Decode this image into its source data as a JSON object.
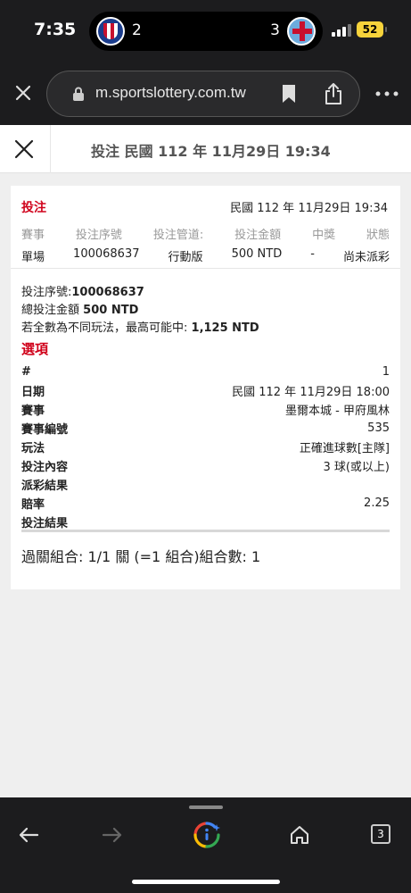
{
  "status_bar": {
    "time": "7:35",
    "live_score": {
      "home_score": "2",
      "away_score": "3"
    },
    "battery": "52"
  },
  "browser": {
    "url": "m.sportslottery.com.tw",
    "tab_count": "3"
  },
  "page": {
    "title": "投注 民國 112 年 11月29日 19:34"
  },
  "bet_card": {
    "label": "投注",
    "datetime": "民國 112 年 11月29日 19:34",
    "summary_headers": [
      "賽事",
      "投注序號",
      "投注管道:",
      "投注金額",
      "中獎",
      "狀態"
    ],
    "summary_values": [
      "單場",
      "100068637",
      "行動版",
      "500 NTD",
      "-",
      "尚未派彩"
    ],
    "serial_label": "投注序號:",
    "serial_value": "100068637",
    "total_label": "總投注金額",
    "total_value": "500 NTD",
    "max_label": "若全數為不同玩法，最高可能中:",
    "max_value": "1,125 NTD",
    "options_title": "選項",
    "details": [
      {
        "key": "#",
        "value": "1"
      },
      {
        "key": "日期",
        "value": "民國 112 年 11月29日 18:00"
      },
      {
        "key": "賽事",
        "value": "墨爾本城 - 甲府風林"
      },
      {
        "key": "賽事編號",
        "value": "535"
      },
      {
        "key": "玩法",
        "value": "正確進球數[主隊]"
      },
      {
        "key": "投注內容",
        "value": "3 球(或以上)"
      },
      {
        "key": "派彩結果",
        "value": ""
      },
      {
        "key": "賠率",
        "value": "2.25"
      },
      {
        "key": "投注結果",
        "value": ""
      }
    ],
    "combo_text": "過關組合: 1/1 關 (=1 組合)組合數: 1"
  },
  "colors": {
    "accent_red": "#d0021b",
    "dark_bar": "#1c1c1e",
    "battery_yellow": "#f7d33b"
  },
  "icons": {
    "toolbar_close": "close-icon",
    "lock": "lock-icon",
    "bookmark": "bookmark-icon",
    "share": "share-icon",
    "more": "more-icon",
    "back": "back-arrow-icon",
    "forward": "forward-arrow-icon",
    "google": "google-lens-icon",
    "home": "home-icon"
  }
}
